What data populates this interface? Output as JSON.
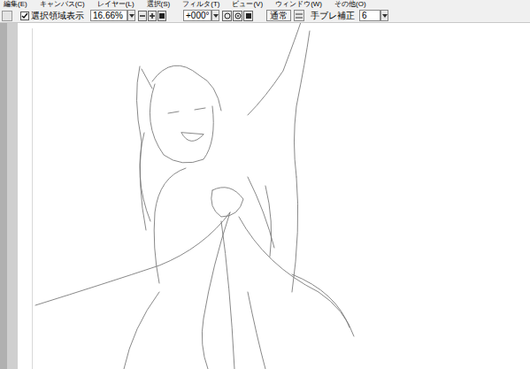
{
  "menu": [
    {
      "label": "編集(E)"
    },
    {
      "label": "キャンバス(C)"
    },
    {
      "label": "レイヤー(L)"
    },
    {
      "label": "選択(S)"
    },
    {
      "label": "フィルタ(T)"
    },
    {
      "label": "ビュー(V)"
    },
    {
      "label": "ウィンドウ(W)"
    },
    {
      "label": "その他(O)"
    }
  ],
  "toolbar": {
    "selection_display": {
      "label": "選択領域表示",
      "checked": true
    },
    "zoom": "16.66%",
    "rotation": "+000°",
    "blend_mode": "通常",
    "stabilizer": {
      "label": "手ブレ補正",
      "value": "6"
    }
  }
}
